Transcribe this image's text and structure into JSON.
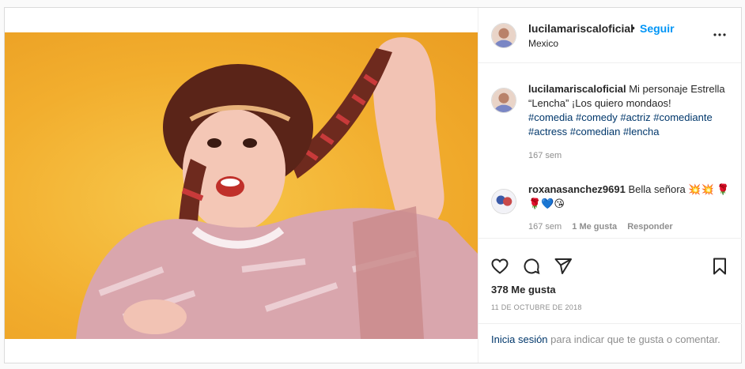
{
  "header": {
    "username": "lucilamariscaloficial",
    "separator": "•",
    "follow_label": "Seguir",
    "location": "Mexico",
    "more_icon": "more-horizontal-icon"
  },
  "caption": {
    "username": "lucilamariscaloficial",
    "text": "Mi personaje Estrella “Lencha” ¡Los quiero mondaos!",
    "hashtags": "#comedia #comedy #actriz #comediante #actress #comedian #lencha",
    "time": "167 sem"
  },
  "comment": {
    "username": "roxanasanchez9691",
    "text": "Bella señora 💥💥 🌹🌹💙😘",
    "time": "167 sem",
    "likes": "1 Me gusta",
    "reply_label": "Responder"
  },
  "actions": {
    "like_icon": "heart-icon",
    "comment_icon": "comment-icon",
    "share_icon": "share-icon",
    "save_icon": "bookmark-icon"
  },
  "likes_text": "378 Me gusta",
  "date_text": "11 DE OCTUBRE DE 2018",
  "login": {
    "link": "Inicia sesión",
    "rest": " para indicar que te gusta o comentar."
  },
  "colors": {
    "accent": "#0095f6",
    "link": "#00376b",
    "muted": "#8e8e8e",
    "photo_bg": "#f2ae2e"
  }
}
